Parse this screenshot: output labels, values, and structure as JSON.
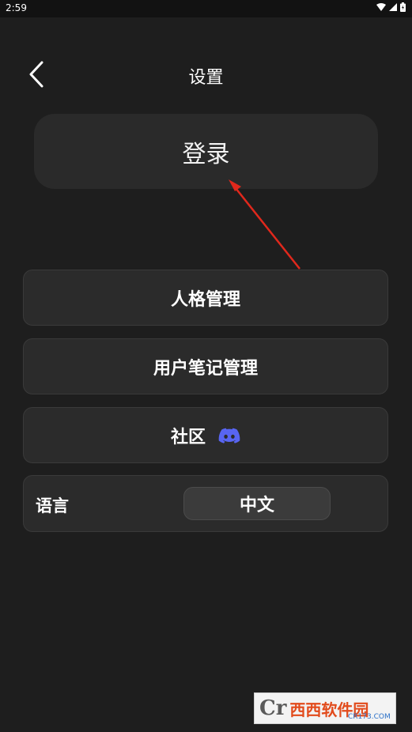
{
  "status_bar": {
    "time": "2:59"
  },
  "header": {
    "title": "设置"
  },
  "login": {
    "label": "登录"
  },
  "menu": {
    "persona": "人格管理",
    "user_notes": "用户笔记管理",
    "community": "社区"
  },
  "language": {
    "label": "语言",
    "value": "中文"
  },
  "watermark": {
    "brand": "西西软件园",
    "domain": "CR173.COM"
  },
  "colors": {
    "background": "#1e1e1e",
    "card": "#2b2b2b",
    "arrow": "#e0281c",
    "discord": "#5865f2"
  }
}
